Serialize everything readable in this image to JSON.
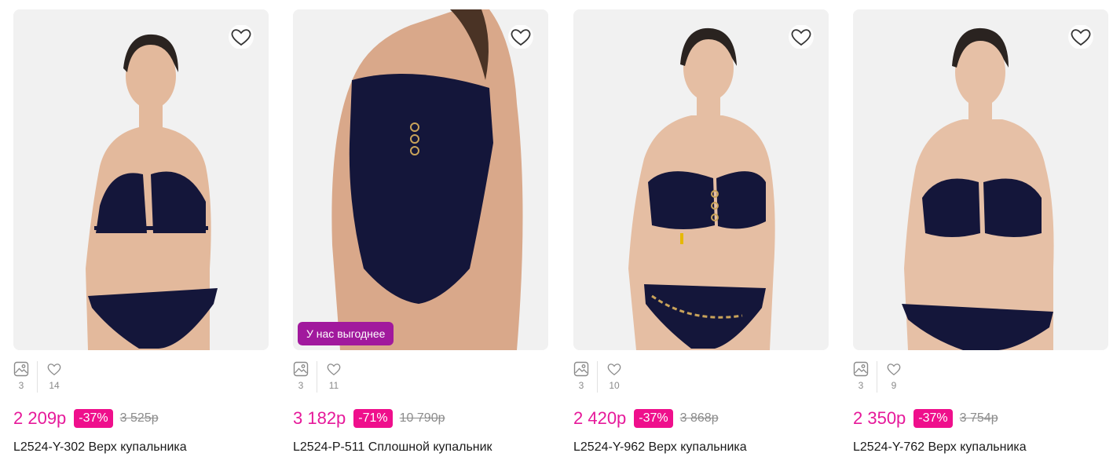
{
  "colors": {
    "price": "#e6199a",
    "discount_badge": "#ef0f8c",
    "promo_badge": "#a1199d",
    "old_price": "#8c8c8c",
    "card_bg": "#f1f1f1"
  },
  "icons": {
    "favorite": "heart-outline-icon",
    "photos": "image-icon",
    "likes": "heart-small-icon"
  },
  "products": [
    {
      "title": "L2524-Y-302 Верх купальника",
      "price": "2 209р",
      "discount": "-37%",
      "old_price": "3 525р",
      "photos": "3",
      "likes": "14",
      "promo": ""
    },
    {
      "title": "L2524-P-511 Сплошной купальник",
      "price": "3 182р",
      "discount": "-71%",
      "old_price": "10 790р",
      "photos": "3",
      "likes": "11",
      "promo": "У нас выгоднее"
    },
    {
      "title": "L2524-Y-962 Верх купальника",
      "price": "2 420р",
      "discount": "-37%",
      "old_price": "3 868р",
      "photos": "3",
      "likes": "10",
      "promo": ""
    },
    {
      "title": "L2524-Y-762 Верх купальника",
      "price": "2 350р",
      "discount": "-37%",
      "old_price": "3 754р",
      "photos": "3",
      "likes": "9",
      "promo": ""
    }
  ]
}
